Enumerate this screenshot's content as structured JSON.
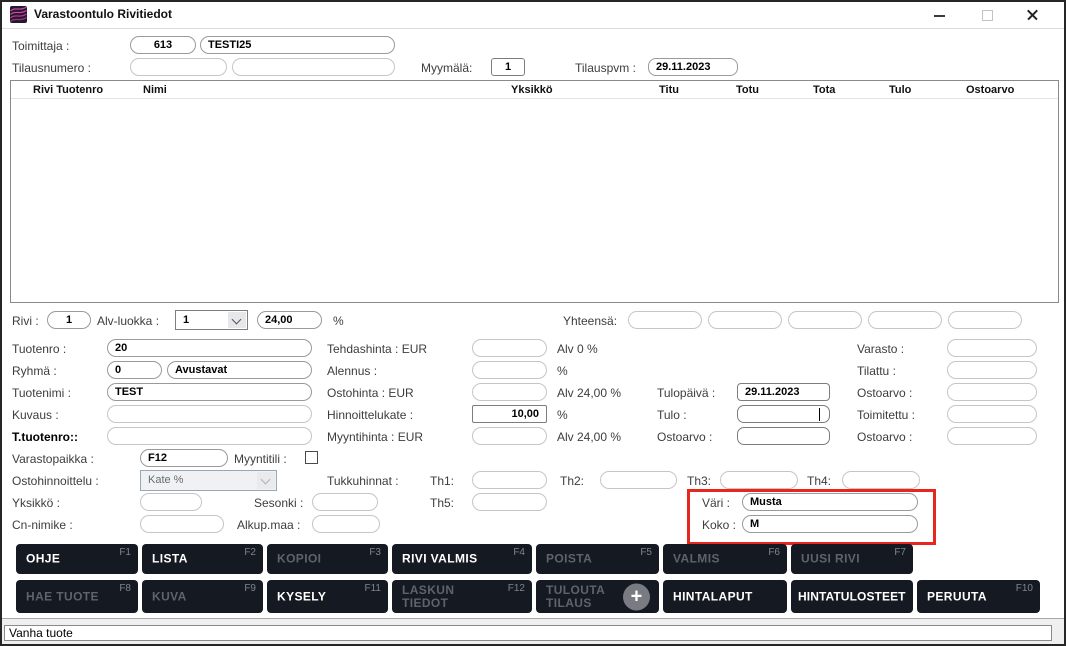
{
  "titlebar": {
    "title": "Varastoontulo Rivitiedot"
  },
  "colors": {
    "highlight_red": "#e8261d",
    "button_bg": "#151922",
    "icon_magenta": "#d8449c"
  },
  "header": {
    "toimittaja": {
      "label": "Toimittaja :",
      "code": "613",
      "name": "TESTI25"
    },
    "tilausnumero": {
      "label": "Tilausnumero :",
      "f1": "",
      "f2": ""
    },
    "myymala": {
      "label": "Myymälä:",
      "value": "1"
    },
    "tilauspvm": {
      "label": "Tilauspvm :",
      "value": "29.11.2023"
    }
  },
  "table": {
    "columns": [
      "Rivi Tuotenro",
      "Nimi",
      "Yksikkö",
      "Titu",
      "Totu",
      "Tota",
      "Tulo",
      "Ostoarvo"
    ],
    "rows": []
  },
  "form": {
    "rivi": {
      "label": "Rivi :",
      "value": "1"
    },
    "alv": {
      "label": "Alv-luokka :",
      "value": "1",
      "pct": "24,00",
      "unit": "%"
    },
    "yhteensa": {
      "label": "Yhteensä:",
      "values": [
        "",
        "",
        "",
        "",
        ""
      ]
    },
    "tuotenro": {
      "label": "Tuotenro :",
      "value": "20"
    },
    "ryhma": {
      "label": "Ryhmä :",
      "code": "0",
      "name": "Avustavat"
    },
    "tuotenimi": {
      "label": "Tuotenimi :",
      "value": "TEST"
    },
    "kuvaus": {
      "label": "Kuvaus :",
      "value": ""
    },
    "t_tuotenro": {
      "label": "T.tuotenro::",
      "value": ""
    },
    "varastopaikka": {
      "label": "Varastopaikka :",
      "value": "F12"
    },
    "myyntitili": {
      "label": "Myyntitili :",
      "checked": false
    },
    "ostohinnoittelu": {
      "label": "Ostohinnoittelu :",
      "value": "Kate %"
    },
    "yksikko": {
      "label": "Yksikkö :",
      "value": ""
    },
    "sesonki": {
      "label": "Sesonki :",
      "value": ""
    },
    "cn_nimike": {
      "label": "Cn-nimike :",
      "value": ""
    },
    "alkup_maa": {
      "label": "Alkup.maa :",
      "value": ""
    },
    "tehdashinta": {
      "label": "Tehdashinta : EUR",
      "value": "",
      "suffix": "Alv 0 %"
    },
    "alennus": {
      "label": "Alennus :",
      "value": "",
      "suffix": "%"
    },
    "ostohinta": {
      "label": "Ostohinta : EUR",
      "value": "",
      "suffix": "Alv 24,00 %"
    },
    "hinnoittelukate": {
      "label": "Hinnoittelukate :",
      "value": "10,00",
      "suffix": "%"
    },
    "myyntihinta": {
      "label": "Myyntihinta : EUR",
      "value": "",
      "suffix": "Alv 24,00 %"
    },
    "tulopaiva": {
      "label": "Tulopäivä :",
      "value": "29.11.2023"
    },
    "tulo": {
      "label": "Tulo :",
      "value": ""
    },
    "ostoarvo_mid": {
      "label": "Ostoarvo :",
      "value": ""
    },
    "varasto": {
      "label": "Varasto :",
      "value": ""
    },
    "tilattu": {
      "label": "Tilattu :",
      "value": ""
    },
    "ostoarvo_r1": {
      "label": "Ostoarvo :",
      "value": ""
    },
    "toimitettu": {
      "label": "Toimitettu :",
      "value": ""
    },
    "ostoarvo_r2": {
      "label": "Ostoarvo :",
      "value": ""
    },
    "tukkuhinnat": {
      "label": "Tukkuhinnat :",
      "th1": "Th1:",
      "th2": "Th2:",
      "th3": "Th3:",
      "th4": "Th4:",
      "th5": "Th5:",
      "th1v": "",
      "th2v": "",
      "th3v": "",
      "th4v": "",
      "th5v": ""
    },
    "vari": {
      "label": "Väri :",
      "value": "Musta"
    },
    "koko": {
      "label": "Koko :",
      "value": "M"
    }
  },
  "buttons": {
    "ohje": {
      "label": "OHJE",
      "key": "F1"
    },
    "lista": {
      "label": "LISTA",
      "key": "F2"
    },
    "kopioi": {
      "label": "KOPIOI",
      "key": "F3"
    },
    "rivi_valmis": {
      "label": "RIVI VALMIS",
      "key": "F4"
    },
    "poista": {
      "label": "POISTA",
      "key": "F5"
    },
    "valmis": {
      "label": "VALMIS",
      "key": "F6"
    },
    "uusi_rivi": {
      "label": "UUSI RIVI",
      "key": "F7"
    },
    "hae_tuote": {
      "label": "HAE TUOTE",
      "key": "F8"
    },
    "kuva": {
      "label": "KUVA",
      "key": "F9"
    },
    "kysely": {
      "label": "KYSELY",
      "key": "F11"
    },
    "laskun_tiedot": {
      "label": "LASKUN\nTIEDOT",
      "key": "F12"
    },
    "tulouta_tilaus": {
      "label": "TULOUTA\nTILAUS",
      "plus": "+"
    },
    "hintalaput": {
      "label": "HINTALAPUT"
    },
    "hintatulosteet": {
      "label": "HINTATULOSTEET"
    },
    "peruuta": {
      "label": "PERUUTA",
      "key": "F10"
    }
  },
  "statusbar": {
    "text": "Vanha tuote"
  }
}
